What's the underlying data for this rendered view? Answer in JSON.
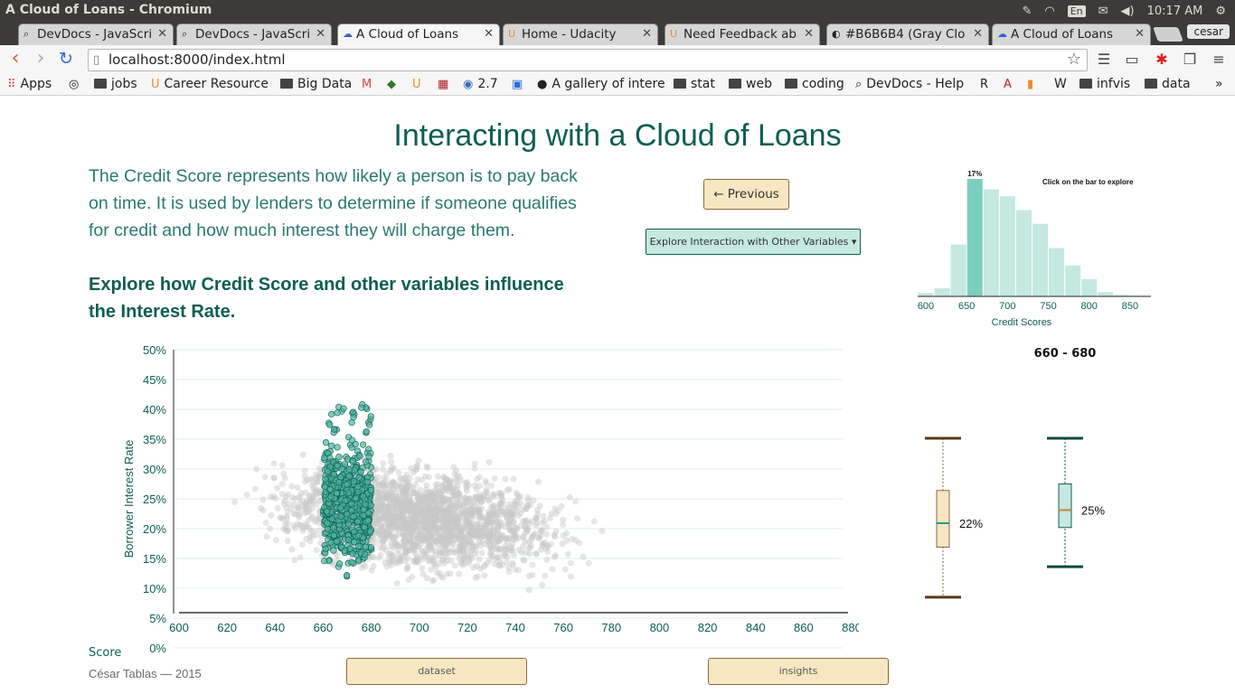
{
  "window": {
    "title": "A Cloud of Loans - Chromium"
  },
  "tray": {
    "lang": "En",
    "time": "10:17 AM",
    "user": "cesar"
  },
  "tabs": [
    {
      "label": "DevDocs - JavaScri",
      "active": false
    },
    {
      "label": "DevDocs - JavaScri",
      "active": false
    },
    {
      "label": "A Cloud of Loans",
      "active": true
    },
    {
      "label": "Home - Udacity",
      "active": false
    },
    {
      "label": "Need Feedback ab",
      "active": false
    },
    {
      "label": "#B6B6B4 (Gray Clo",
      "active": false
    },
    {
      "label": "A Cloud of Loans",
      "active": false
    }
  ],
  "address": {
    "url": "localhost:8000/index.html"
  },
  "bookmarks": [
    {
      "label": "Apps"
    },
    {
      "label": ""
    },
    {
      "label": "jobs"
    },
    {
      "label": "Career Resource"
    },
    {
      "label": "Big Data"
    },
    {
      "label": ""
    },
    {
      "label": ""
    },
    {
      "label": ""
    },
    {
      "label": ""
    },
    {
      "label": "2.7"
    },
    {
      "label": ""
    },
    {
      "label": "A gallery of intere"
    },
    {
      "label": "stat"
    },
    {
      "label": "web"
    },
    {
      "label": "coding"
    },
    {
      "label": "DevDocs - Help"
    },
    {
      "label": ""
    },
    {
      "label": ""
    },
    {
      "label": ""
    },
    {
      "label": "W"
    },
    {
      "label": "infvis"
    },
    {
      "label": "data"
    }
  ],
  "page": {
    "heading": "Interacting with a Cloud of Loans",
    "intro": "The Credit Score represents how likely a person is to pay back on time. It is used by lenders to determine if someone qualifies for credit and how much interest they will charge them.",
    "subheading": "Explore how Credit Score and other variables influence the Interest Rate.",
    "prev_button": "← Previous",
    "explore_button": "Explore Interaction with Other Variables ▾",
    "footer": "César Tablas — 2015",
    "dataset_button": "dataset",
    "insights_button": "insights",
    "range_label": "660 - 680",
    "score_label_fragment": "Score"
  },
  "colors": {
    "teal_dark": "#0e5e53",
    "teal_highlight": "#4fb3a0",
    "teal_light": "#c5e8e1",
    "gray_points": "#c8c8c8",
    "wheat": "#f7e6c2",
    "brown": "#5a3a12"
  },
  "chart_data": [
    {
      "type": "bar",
      "title": "Click on the bar to explore",
      "xlabel": "Credit Scores",
      "x_ticks": [
        "600",
        "650",
        "700",
        "750",
        "800",
        "850"
      ],
      "bins": [
        600,
        620,
        640,
        660,
        680,
        700,
        720,
        740,
        760,
        780,
        800,
        820,
        840,
        860,
        880
      ],
      "values": [
        0.5,
        1.2,
        7.5,
        17,
        15.5,
        14.5,
        12.5,
        10.5,
        7,
        4.5,
        2.5,
        0.6,
        0.2,
        0.1
      ],
      "selected_bin": "660 - 680",
      "selected_label": "17%"
    },
    {
      "type": "scatter",
      "xlabel": "Credit Score",
      "ylabel": "Borrower Interest Rate",
      "xlim": [
        600,
        880
      ],
      "ylim": [
        0,
        50
      ],
      "x_ticks": [
        "600",
        "620",
        "640",
        "660",
        "680",
        "700",
        "720",
        "740",
        "760",
        "780",
        "800",
        "820",
        "840",
        "860",
        "880"
      ],
      "y_ticks": [
        "0%",
        "5%",
        "10%",
        "15%",
        "20%",
        "25%",
        "30%",
        "35%",
        "40%",
        "45%",
        "50%"
      ],
      "highlight_range": [
        660,
        680
      ],
      "series": [
        {
          "role": "background",
          "x_range": [
            600,
            860
          ],
          "y_range": [
            7,
            36
          ]
        },
        {
          "role": "highlight",
          "x_range": [
            660,
            680
          ],
          "y_range": [
            12,
            41
          ]
        }
      ]
    },
    {
      "type": "box",
      "ylim": [
        0,
        50
      ],
      "boxes": [
        {
          "min": 5,
          "q1": 16.5,
          "median": 22,
          "q3": 29.5,
          "max": 41.5,
          "median_label": "22%"
        },
        {
          "min": 12,
          "q1": 21,
          "median": 25,
          "q3": 31,
          "max": 41.5,
          "median_label": "25%"
        }
      ]
    }
  ]
}
